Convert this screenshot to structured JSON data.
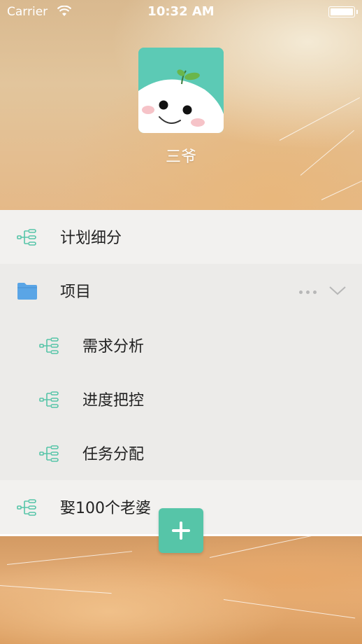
{
  "status_bar": {
    "carrier": "Carrier",
    "time": "10:32 AM"
  },
  "profile": {
    "name": "三爷"
  },
  "list": {
    "items": [
      {
        "label": "计划细分",
        "icon": "mindmap-icon"
      },
      {
        "label": "项目",
        "icon": "folder-icon"
      },
      {
        "label": "需求分析",
        "icon": "mindmap-icon"
      },
      {
        "label": "进度把控",
        "icon": "mindmap-icon"
      },
      {
        "label": "任务分配",
        "icon": "mindmap-icon"
      },
      {
        "label": "娶100个老婆",
        "icon": "mindmap-icon"
      }
    ]
  },
  "colors": {
    "accent": "#56c5a8",
    "folder": "#5aa5e6"
  },
  "icons": {
    "add": "plus-icon",
    "more": "more-dots-icon",
    "expand": "chevron-down-icon"
  }
}
